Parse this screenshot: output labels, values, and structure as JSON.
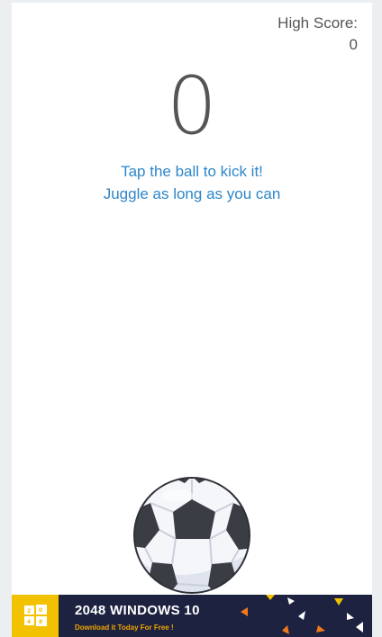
{
  "high_score": {
    "label": "High Score:",
    "value": "0"
  },
  "score": "0",
  "instructions": {
    "line1": "Tap the ball to kick it!",
    "line2": "Juggle as long as you can"
  },
  "ball": {
    "icon": "soccer-ball-icon"
  },
  "ad": {
    "title": "2048 WINDOWS 10",
    "subtitle": "Download it Today For Free !",
    "logo_icon": "windows-2048-logo-icon",
    "colors": {
      "background": "#1d2240",
      "logo": "#f2c200",
      "subtitle": "#f0a500",
      "accent": "#f07a1a"
    }
  }
}
